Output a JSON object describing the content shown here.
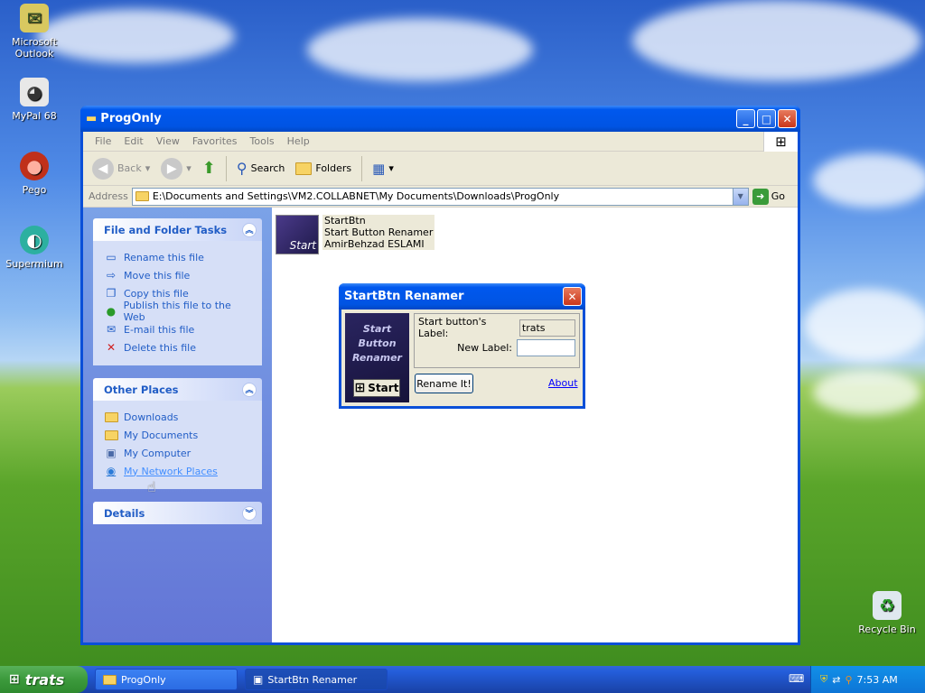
{
  "desktop": {
    "icons": [
      {
        "label": "Microsoft Outlook",
        "icon": "outlook-icon"
      },
      {
        "label": "MyPal 68",
        "icon": "raccoon-icon"
      },
      {
        "label": "Pego",
        "icon": "pego-icon"
      },
      {
        "label": "Supermium",
        "icon": "supermium-icon"
      },
      {
        "label": "Recycle Bin",
        "icon": "recycle-bin-icon"
      }
    ]
  },
  "explorer": {
    "title": "ProgOnly",
    "menu": [
      "File",
      "Edit",
      "View",
      "Favorites",
      "Tools",
      "Help"
    ],
    "toolbar": {
      "back": "Back",
      "search": "Search",
      "folders": "Folders"
    },
    "address": {
      "label": "Address",
      "value": "E:\\Documents and Settings\\VM2.COLLABNET\\My Documents\\Downloads\\ProgOnly",
      "go": "Go"
    },
    "file_tasks": {
      "title": "File and Folder Tasks",
      "items": [
        "Rename this file",
        "Move this file",
        "Copy this file",
        "Publish this file to the Web",
        "E-mail this file",
        "Delete this file"
      ]
    },
    "other_places": {
      "title": "Other Places",
      "items": [
        "Downloads",
        "My Documents",
        "My Computer",
        "My Network Places"
      ]
    },
    "details": {
      "title": "Details"
    },
    "file": {
      "name": "StartBtn",
      "description": "Start Button Renamer",
      "author": "AmirBehzad ESLAMI",
      "icon_caption": "Start"
    }
  },
  "dialog": {
    "title": "StartBtn Renamer",
    "image_text": [
      "Start",
      "Button",
      "Renamer"
    ],
    "image_start": "Start",
    "label_current": "Start button's Label:",
    "current_value": "trats",
    "label_new": "New Label:",
    "new_value": "",
    "rename_button": "Rename It!",
    "about_link": "About"
  },
  "taskbar": {
    "start_label": "trats",
    "tasks": [
      "ProgOnly",
      "StartBtn Renamer"
    ],
    "clock": "7:53 AM"
  }
}
